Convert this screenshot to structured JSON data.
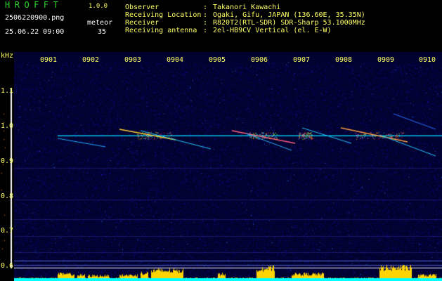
{
  "header": {
    "logo": "HROFFT",
    "version": "1.0.0",
    "filename": "2506220900.png",
    "datetime": "25.06.22 09:00",
    "meteor_label": "meteor",
    "meteor_count": "35"
  },
  "info": [
    {
      "label": "Observer",
      "value": "Takanori Kawachi"
    },
    {
      "label": "Receiving Location",
      "value": "Ogaki, Gifu, JAPAN (136.60E, 35.35N)"
    },
    {
      "label": "Receiver",
      "value": "R820T2(RTL-SDR) SDR-Sharp 53.1000MHz"
    },
    {
      "label": "Receiving antenna",
      "value": "2el-HB9CV Vertical (el. E-W)"
    }
  ],
  "axis": {
    "unit": "kHz",
    "y_ticks": [
      "1.1",
      "1.0",
      "0.9",
      "0.8",
      "0.7",
      "0.6"
    ],
    "x_ticks": [
      "0901",
      "0902",
      "0903",
      "0904",
      "0905",
      "0906",
      "0907",
      "0908",
      "0909",
      "0910"
    ]
  },
  "colors": {
    "green": "#27d827",
    "yellow": "#ffff66",
    "background": "#000000",
    "noise": "#0a0a7a",
    "carrier": "#00e0ff",
    "baseline": "#00ffff",
    "echo_bar": "#ffd400"
  }
}
